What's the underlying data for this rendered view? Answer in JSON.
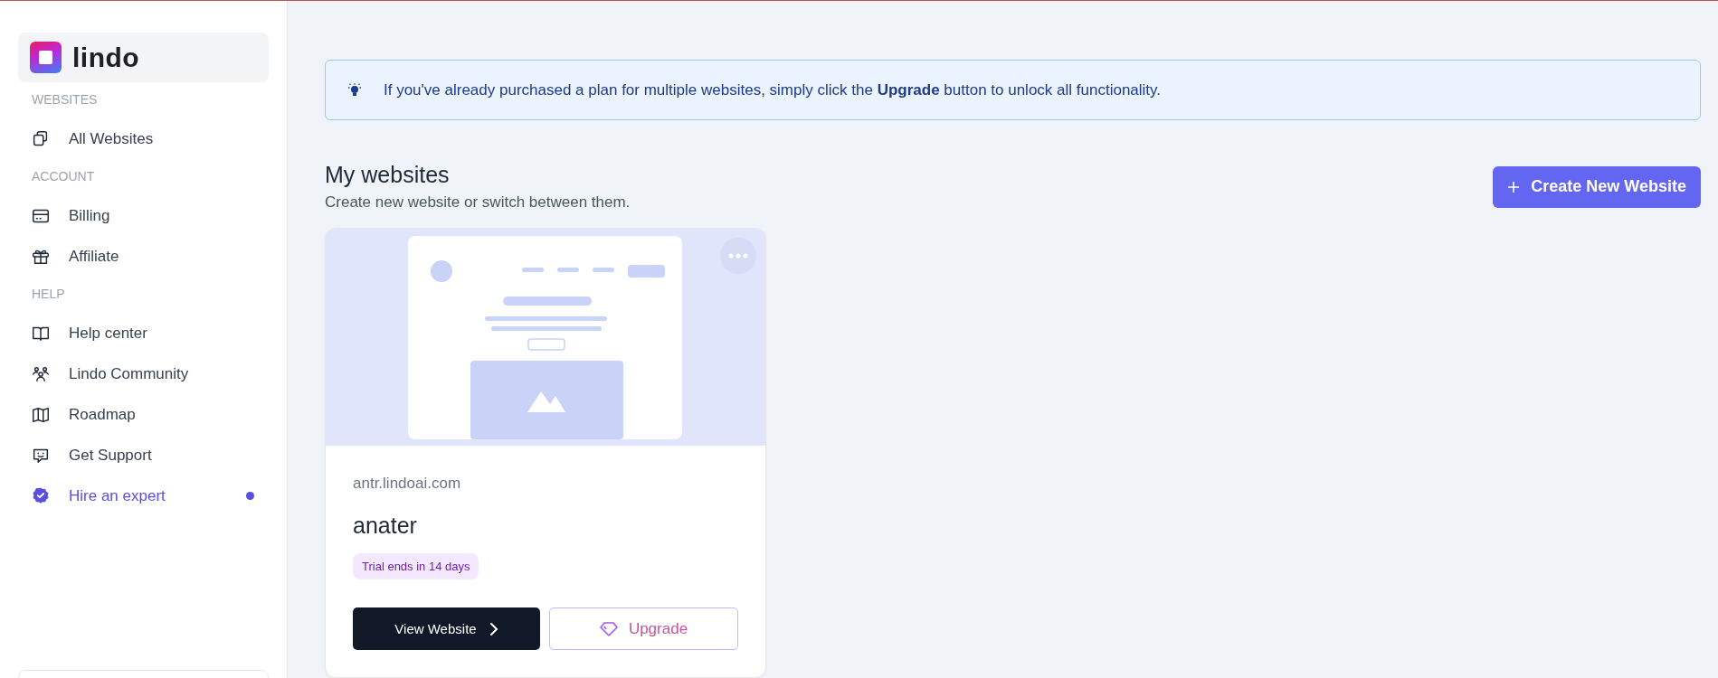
{
  "logo": {
    "text": "lindo"
  },
  "sidebar": {
    "sections": [
      {
        "heading": "WEBSITES",
        "items": [
          {
            "label": "All Websites",
            "accent": false
          }
        ]
      },
      {
        "heading": "ACCOUNT",
        "items": [
          {
            "label": "Billing",
            "accent": false
          },
          {
            "label": "Affiliate",
            "accent": false
          }
        ]
      },
      {
        "heading": "HELP",
        "items": [
          {
            "label": "Help center",
            "accent": false
          },
          {
            "label": "Lindo Community",
            "accent": false
          },
          {
            "label": "Roadmap",
            "accent": false
          },
          {
            "label": "Get Support",
            "accent": false
          },
          {
            "label": "Hire an expert",
            "accent": true
          }
        ]
      }
    ]
  },
  "notice": {
    "text": "If you've already purchased a plan for multiple websites, simply click the **Upgrade** button to unlock all functionality."
  },
  "header": {
    "title": "My websites",
    "subtitle": "Create new website or switch between them.",
    "button": "Create New Website"
  },
  "websites": [
    {
      "domain": "antr.lindoai.com",
      "name": "anater",
      "badge": "Trial ends in 14 days",
      "primary_button": "View Website",
      "secondary_button": "Upgrade"
    }
  ]
}
